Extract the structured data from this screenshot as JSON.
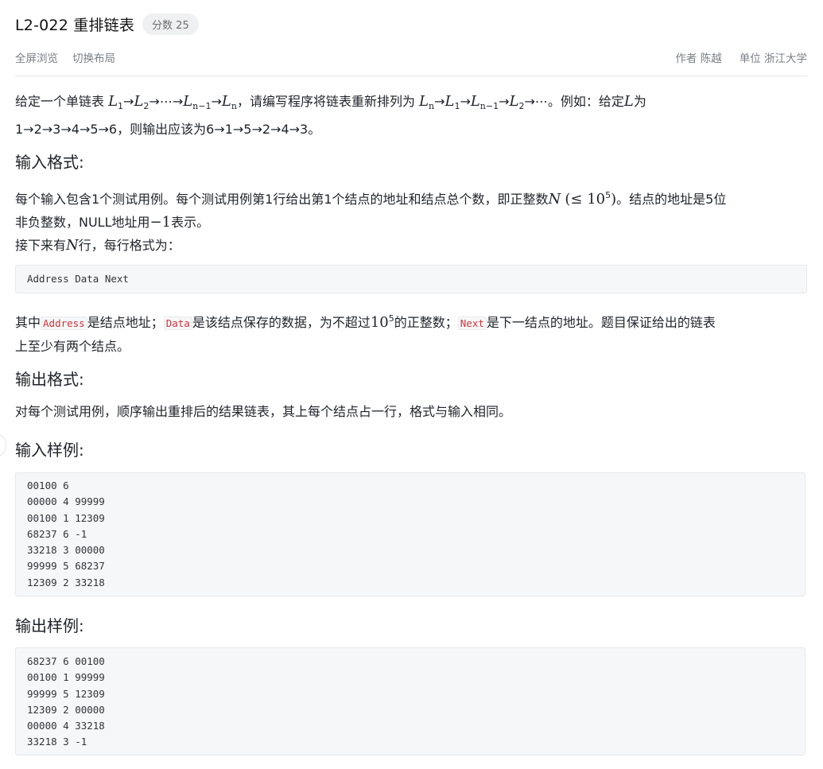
{
  "problem": {
    "title": "L2-022 重排链表",
    "score_label": "分数 25"
  },
  "toolbar": {
    "fullscreen": "全屏浏览",
    "switch_layout": "切换布局",
    "author_label": "作者",
    "author_name": "陈越",
    "unit_label": "单位",
    "unit_name": "浙江大学"
  },
  "description": {
    "line1_a": "给定一个单链表 ",
    "line1_b": "，请编写程序将链表重新排列为 ",
    "line1_c": "。例如：给定",
    "line1_d": "为",
    "line2": "1→2→3→4→5→6，则输出应该为6→1→5→2→4→3。"
  },
  "input_format": {
    "heading": "输入格式:",
    "p1_a": "每个输入包含1个测试用例。每个测试用例第1行给出第1个结点的地址和结点总个数，即正整数",
    "p1_b": "。结点的地址是5位",
    "p1_line2_a": "非负整数，NULL地址用",
    "p1_line2_b": "表示。",
    "p2_a": "接下来有",
    "p2_b": "行，每行格式为：",
    "format_code": "Address Data Next",
    "p3_a": "其中",
    "code_address": "Address",
    "p3_b": "是结点地址；",
    "code_data": "Data",
    "p3_c": "是该结点保存的数据，为不超过",
    "p3_d": "的正整数；",
    "code_next": "Next",
    "p3_e": "是下一结点的地址。题目保证给出的链表",
    "p3_line2": "上至少有两个结点。"
  },
  "output_format": {
    "heading": "输出格式:",
    "p1": "对每个测试用例，顺序输出重排后的结果链表，其上每个结点占一行，格式与输入相同。"
  },
  "sample_input": {
    "heading": "输入样例:",
    "lines": [
      "00100 6",
      "00000 4 99999",
      "00100 1 12309",
      "68237 6 -1",
      "33218 3 00000",
      "99999 5 68237",
      "12309 2 33218"
    ]
  },
  "sample_output": {
    "heading": "输出样例:",
    "lines": [
      "68237 6 00100",
      "00100 1 99999",
      "99999 5 12309",
      "12309 2 00000",
      "00000 4 33218",
      "33218 3 -1"
    ]
  }
}
